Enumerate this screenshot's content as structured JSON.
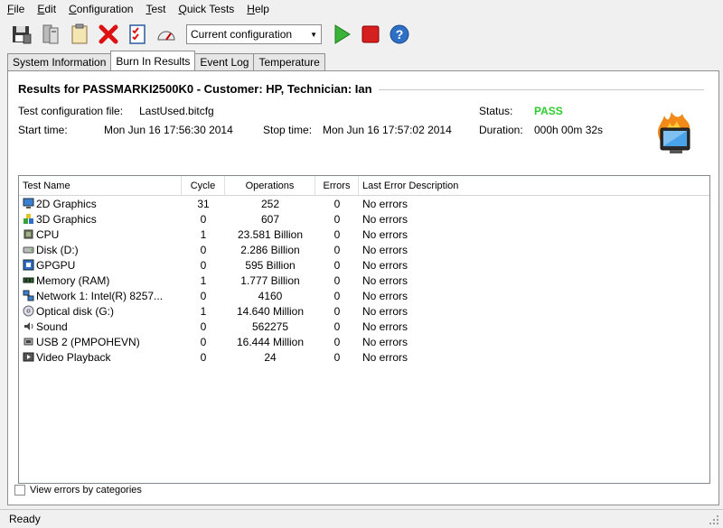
{
  "menubar": {
    "items": [
      {
        "first": "F",
        "rest": "ile"
      },
      {
        "first": "E",
        "rest": "dit"
      },
      {
        "first": "C",
        "rest": "onfiguration"
      },
      {
        "first": "T",
        "rest": "est"
      },
      {
        "first": "Q",
        "rest": "uick Tests"
      },
      {
        "first": "H",
        "rest": "elp"
      }
    ]
  },
  "toolbar": {
    "config_value": "Current configuration"
  },
  "tabs": [
    {
      "label": "System Information"
    },
    {
      "label": "Burn In Results"
    },
    {
      "label": "Event Log"
    },
    {
      "label": "Temperature"
    }
  ],
  "results": {
    "title": "Results for PASSMARKI2500K0 - Customer: HP, Technician: Ian",
    "config_label": "Test configuration file:",
    "config_file": "LastUsed.bitcfg",
    "start_label": "Start time:",
    "start_time": "Mon Jun 16 17:56:30 2014",
    "stop_label": "Stop time:",
    "stop_time": "Mon Jun 16 17:57:02 2014",
    "status_label": "Status:",
    "status_value": "PASS",
    "duration_label": "Duration:",
    "duration_value": "000h 00m 32s",
    "status_color": "#2ecc2e"
  },
  "table": {
    "headers": {
      "name": "Test Name",
      "cycle": "Cycle",
      "ops": "Operations",
      "errors": "Errors",
      "desc": "Last Error Description"
    },
    "rows": [
      {
        "icon": "monitor-icon",
        "name": "2D Graphics",
        "cycle": "31",
        "ops": "252",
        "errors": "0",
        "desc": "No errors"
      },
      {
        "icon": "cubes-icon",
        "name": "3D Graphics",
        "cycle": "0",
        "ops": "607",
        "errors": "0",
        "desc": "No errors"
      },
      {
        "icon": "cpu-icon",
        "name": "CPU",
        "cycle": "1",
        "ops": "23.581 Billion",
        "errors": "0",
        "desc": "No errors"
      },
      {
        "icon": "disk-icon",
        "name": "Disk (D:)",
        "cycle": "0",
        "ops": "2.286 Billion",
        "errors": "0",
        "desc": "No errors"
      },
      {
        "icon": "gpgpu-icon",
        "name": "GPGPU",
        "cycle": "0",
        "ops": "595 Billion",
        "errors": "0",
        "desc": "No errors"
      },
      {
        "icon": "memory-icon",
        "name": "Memory (RAM)",
        "cycle": "1",
        "ops": "1.777 Billion",
        "errors": "0",
        "desc": "No errors"
      },
      {
        "icon": "network-icon",
        "name": "Network 1: Intel(R) 8257...",
        "cycle": "0",
        "ops": "4160",
        "errors": "0",
        "desc": "No errors"
      },
      {
        "icon": "optical-disc-icon",
        "name": "Optical disk (G:)",
        "cycle": "1",
        "ops": "14.640 Million",
        "errors": "0",
        "desc": "No errors"
      },
      {
        "icon": "speaker-icon",
        "name": "Sound",
        "cycle": "0",
        "ops": "562275",
        "errors": "0",
        "desc": "No errors"
      },
      {
        "icon": "usb-icon",
        "name": "USB 2 (PMPOHEVN)",
        "cycle": "0",
        "ops": "16.444 Million",
        "errors": "0",
        "desc": "No errors"
      },
      {
        "icon": "video-icon",
        "name": "Video Playback",
        "cycle": "0",
        "ops": "24",
        "errors": "0",
        "desc": "No errors"
      }
    ]
  },
  "options": {
    "view_errors_label": "View errors by categories"
  },
  "status_bar": {
    "text": "Ready"
  }
}
